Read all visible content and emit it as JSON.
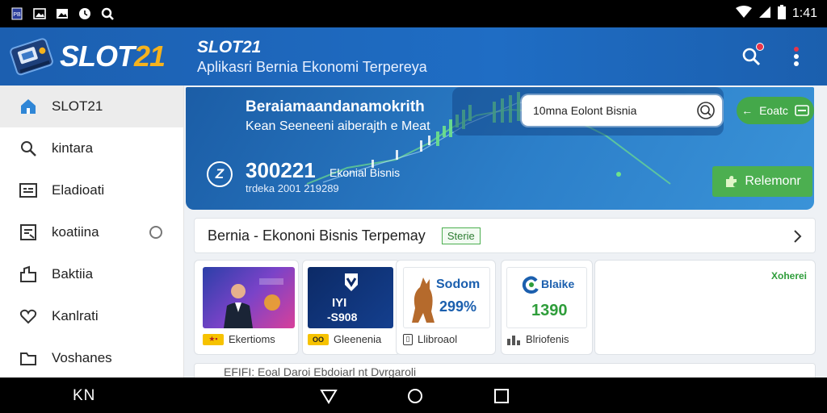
{
  "status_bar": {
    "time": "1:41",
    "icons": [
      "app-notification-icon",
      "image-icon",
      "image-icon",
      "clock-icon",
      "search-icon"
    ],
    "right_icons": [
      "wifi-icon",
      "signal-icon",
      "battery-icon"
    ]
  },
  "header": {
    "logo_part1": "SLOT",
    "logo_part2": "21",
    "title": "SLOT21",
    "subtitle": "Aplikasri Bernia Ekonomi Terpereya",
    "actions": [
      "search-icon",
      "more-vert-icon"
    ]
  },
  "sidebar": {
    "items": [
      {
        "label": "SLOT21",
        "icon": "home-icon",
        "active": true
      },
      {
        "label": "kintara",
        "icon": "search-icon",
        "active": false
      },
      {
        "label": "Eladioati",
        "icon": "list-icon",
        "active": false
      },
      {
        "label": "koatiina",
        "icon": "document-icon",
        "active": false
      },
      {
        "label": "Baktiia",
        "icon": "bag-icon",
        "active": false
      },
      {
        "label": "Kanlrati",
        "icon": "heart-icon",
        "active": false
      },
      {
        "label": "Voshanes",
        "icon": "folder-icon",
        "active": false
      }
    ]
  },
  "banner": {
    "heading": "Beraiamaandanamokrith",
    "subheading": "Kean Seeneeni aiberajth e Meat",
    "logo_glyph": "Z",
    "value": "300221",
    "value_label": "Ekonial Bisnis",
    "value_sub": "trdeka 2001 219289",
    "search_text": "10mna Eolont Bisnia",
    "pill_label": "Eoatc",
    "green_button_label": "Relemonr"
  },
  "info_row": {
    "title": "Bernia - Ekononi Bisnis Terpemay",
    "badge": "Sterie"
  },
  "cards": [
    {
      "label": "Ekertioms",
      "badge": "★▪",
      "image_text": "",
      "badge_color": "#f6c200"
    },
    {
      "label": "Gleenenia",
      "badge": "OO",
      "image_text_1": "IYI",
      "image_text_2": "-S908",
      "badge_color": "#f6c200"
    },
    {
      "label": "Llibroaol",
      "badge": "▯",
      "image_text_1": "Sodom",
      "image_text_2": "299%",
      "badge_color": "#ffffff"
    },
    {
      "label": "Blriofenis",
      "badge": "▮▮",
      "image_text_1": "Blaike",
      "image_text_2": "1390",
      "badge_color": "#ffffff"
    }
  ],
  "big_card_label": "Xoherei",
  "bottom_strip_text": "EFIFI: Eoal Daroi Ebdoiarl nt Dvrgaroli",
  "nav_bar": {
    "left_label": "KN",
    "buttons": [
      "back-icon",
      "home-icon",
      "recents-icon"
    ]
  },
  "colors": {
    "header_blue": "#1f6dc4",
    "accent_gold": "#f6b21c",
    "green": "#4caf50",
    "notif_red": "#e8354a"
  }
}
